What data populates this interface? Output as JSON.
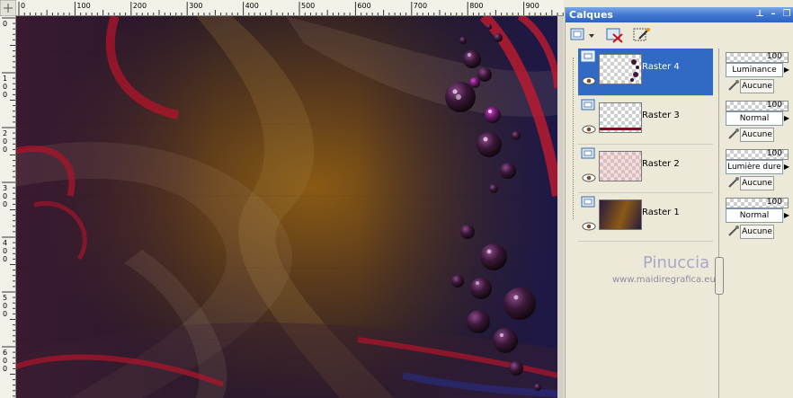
{
  "ruler": {
    "top_labels": [
      "0",
      "100",
      "200",
      "300",
      "400",
      "500",
      "600",
      "700",
      "800",
      "900"
    ],
    "left_labels": [
      "0",
      "1",
      "2",
      "3",
      "4",
      "5",
      "6"
    ]
  },
  "palette": {
    "title": "Calques",
    "layers": [
      {
        "name": "Raster 4",
        "opacity": "100",
        "blend": "Luminance",
        "mask": "Aucune",
        "selected": true
      },
      {
        "name": "Raster 3",
        "opacity": "100",
        "blend": "Normal",
        "mask": "Aucune",
        "selected": false
      },
      {
        "name": "Raster 2",
        "opacity": "100",
        "blend": "Lumière dure",
        "mask": "Aucune",
        "selected": false
      },
      {
        "name": "Raster 1",
        "opacity": "100",
        "blend": "Normal",
        "mask": "Aucune",
        "selected": false
      }
    ]
  },
  "watermark": {
    "title": "Pinuccia",
    "url": "www.maidiregrafica.eu"
  },
  "colors": {
    "titlebar": "#3f74cf",
    "selection": "#316ac5",
    "panel_bg": "#ece9d8"
  },
  "icons": {
    "new_layer": "new-layer-icon",
    "delete_layer": "delete-layer-icon",
    "edit": "edit-wand-icon",
    "eye": "eye-icon",
    "mask": "mask-brush-icon"
  }
}
